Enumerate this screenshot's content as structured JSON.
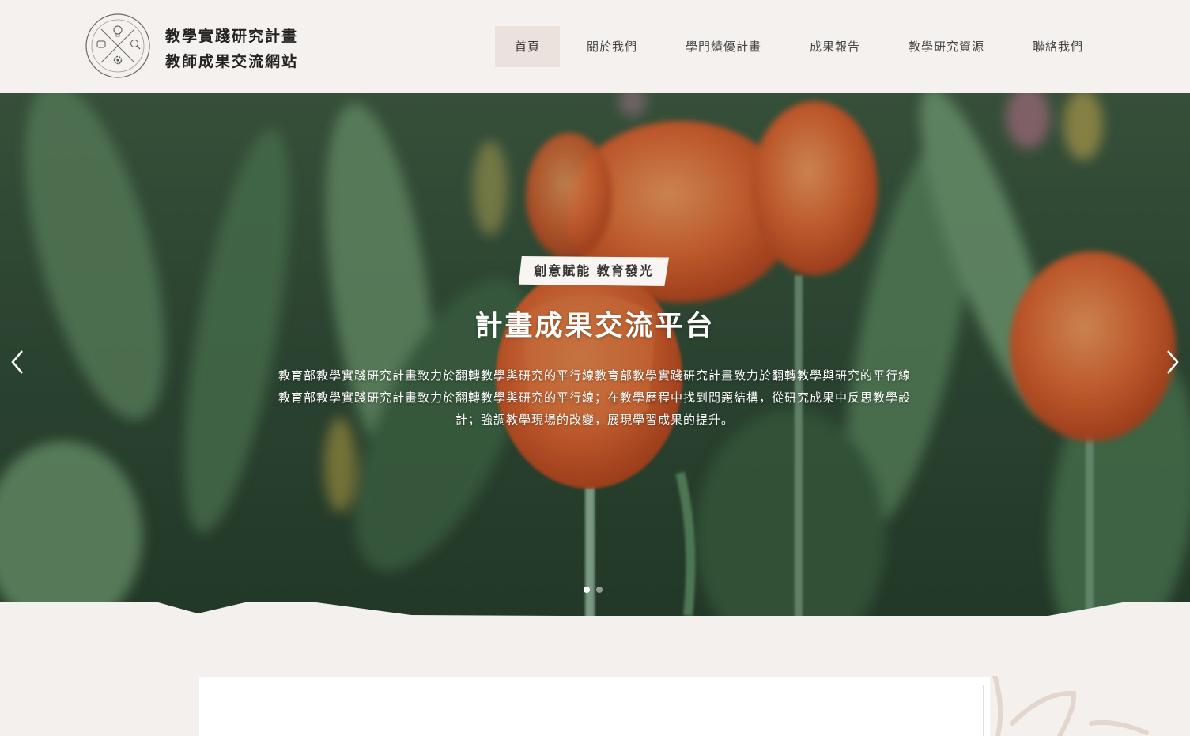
{
  "header": {
    "logo_icon": "teaching-research-emblem-icon",
    "title_line1": "教學實踐研究計畫",
    "title_line2": "教師成果交流網站"
  },
  "nav": {
    "items": [
      {
        "label": "首頁",
        "active": true
      },
      {
        "label": "關於我們",
        "active": false
      },
      {
        "label": "學門績優計畫",
        "active": false
      },
      {
        "label": "成果報告",
        "active": false
      },
      {
        "label": "教學研究資源",
        "active": false
      },
      {
        "label": "聯絡我們",
        "active": false
      }
    ]
  },
  "hero": {
    "tag": "創意賦能 教育發光",
    "title": "計畫成果交流平台",
    "description": "教育部教學實踐研究計畫致力於翻轉教學與研究的平行線教育部教學實踐研究計畫致力於翻轉教學與研究的平行線教育部教學實踐研究計畫致力於翻轉教學與研究的平行線；在教學歷程中找到問題結構，從研究成果中反思教學設計；強調教學現場的改變，展現學習成果的提升。",
    "prev_icon": "chevron-left-icon",
    "next_icon": "chevron-right-icon",
    "slides": 2,
    "active_slide": 1
  },
  "colors": {
    "page_bg": "#f3f0ed",
    "nav_active_bg": "#ebe2dd",
    "tag_bg": "#f8f5f2",
    "text_dark": "#222222"
  }
}
